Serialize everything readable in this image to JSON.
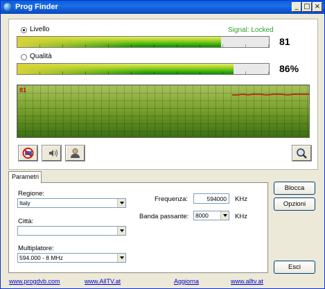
{
  "window": {
    "title": "Prog Finder",
    "controls": {
      "minimize": "_",
      "maximize": "□",
      "close": "×"
    }
  },
  "signal": {
    "level_label": "Livello",
    "quality_label": "Qualità",
    "status_text": "Signal: Locked",
    "status_color": "#2e9e2e",
    "level_value": "81",
    "level_fraction": 0.81,
    "quality_value": "86%",
    "quality_fraction": 0.86,
    "selected": "Livello"
  },
  "graph": {
    "label": "81",
    "line_color": "#c01010",
    "level_fraction": 0.81
  },
  "toolbar": {
    "icons": [
      "no-signal-icon",
      "audio-signal-icon",
      "person-icon",
      "magnifier-icon"
    ]
  },
  "tab": {
    "label": "Parametri"
  },
  "params": {
    "regione_label": "Regione:",
    "regione_value": "Italy",
    "citta_label": "Città:",
    "citta_value": "",
    "multiplatore_label": "Multiplatore:",
    "multiplatore_value": "594.000 - 8 MHz",
    "frequenza_label": "Frequenza:",
    "frequenza_value": "594000",
    "frequenza_unit": "KHz",
    "banda_label": "Banda passante:",
    "banda_value": "8000",
    "banda_unit": "KHz"
  },
  "buttons": {
    "blocca": "Blocca",
    "opzioni": "Opzioni",
    "esci": "Esci"
  },
  "links": {
    "progdvb": "www.progdvb.com",
    "alltv_upper": "www.AllTV.at",
    "aggiorna": "Aggiorna",
    "alltv_lower": "www.alltv.at"
  }
}
